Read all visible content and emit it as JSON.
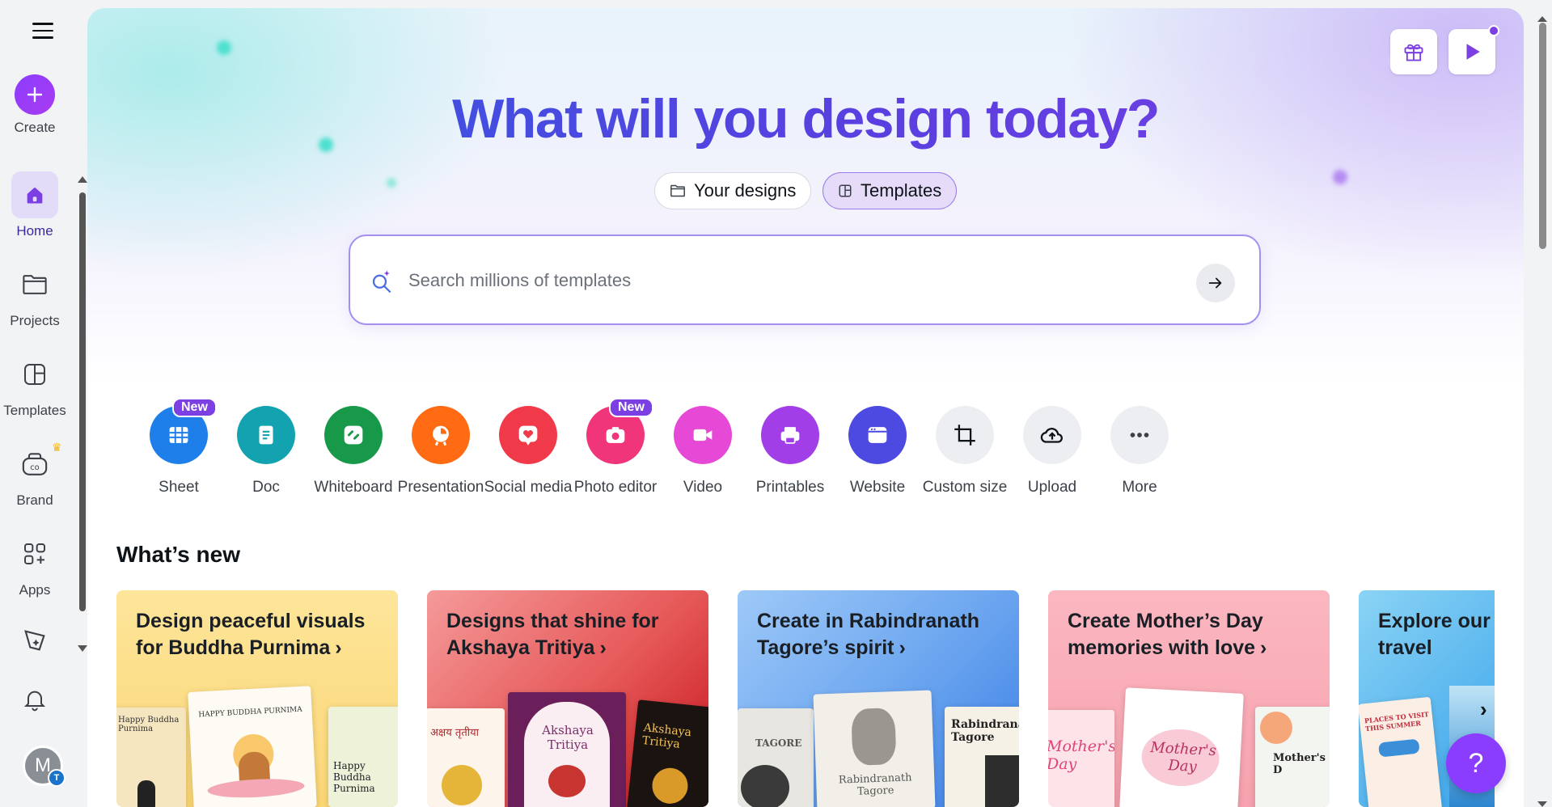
{
  "rail": {
    "create_label": "Create",
    "items": [
      {
        "label": "Home"
      },
      {
        "label": "Projects"
      },
      {
        "label": "Templates"
      },
      {
        "label": "Brand"
      },
      {
        "label": "Apps"
      }
    ],
    "avatar_initial": "M",
    "team_initial": "T"
  },
  "hero": {
    "title": "What will you design today?",
    "tabs": [
      {
        "label": "Your designs",
        "active": false
      },
      {
        "label": "Templates",
        "active": true
      }
    ]
  },
  "search": {
    "placeholder": "Search millions of templates"
  },
  "shortcuts": [
    {
      "label": "Sheet",
      "color": "#1f7fea",
      "badge": "New",
      "icon": "sheet-icon"
    },
    {
      "label": "Doc",
      "color": "#13a3b0",
      "badge": "",
      "icon": "doc-icon"
    },
    {
      "label": "Whiteboard",
      "color": "#18994a",
      "badge": "",
      "icon": "whiteboard-icon"
    },
    {
      "label": "Presentation",
      "color": "#ff6a13",
      "badge": "",
      "icon": "presentation-icon"
    },
    {
      "label": "Social media",
      "color": "#f03a4a",
      "badge": "",
      "icon": "heart-icon"
    },
    {
      "label": "Photo editor",
      "color": "#f0357a",
      "badge": "New",
      "icon": "camera-icon"
    },
    {
      "label": "Video",
      "color": "#e649d6",
      "badge": "",
      "icon": "video-icon"
    },
    {
      "label": "Printables",
      "color": "#a23ee8",
      "badge": "",
      "icon": "printer-icon"
    },
    {
      "label": "Website",
      "color": "#4c4ae0",
      "badge": "",
      "icon": "website-icon"
    },
    {
      "label": "Custom size",
      "color": "#eceef1",
      "badge": "",
      "icon": "crop-icon"
    },
    {
      "label": "Upload",
      "color": "#eceef1",
      "badge": "",
      "icon": "cloud-upload-icon"
    },
    {
      "label": "More",
      "color": "#eceef1",
      "badge": "",
      "icon": "more-icon"
    }
  ],
  "whats_new": {
    "title": "What’s new",
    "cards": [
      {
        "title": "Design peaceful visuals for Buddha Purnima",
        "bg": "#fde08a",
        "thumbs": [
          "Happy Buddha Purnima",
          "HAPPY BUDDHA PURNIMA",
          "Happy Buddha Purnima"
        ]
      },
      {
        "title": "Designs that shine for Akshaya Tritiya",
        "bg": "#e34a4a",
        "thumbs": [
          "अक्षय तृतीया",
          "Akshaya Tritiya",
          "Akshaya Tritiya"
        ]
      },
      {
        "title": "Create in Rabindranath Tagore’s spirit",
        "bg": "#6fa8f0",
        "thumbs": [
          "TAGORE",
          "Rabindranath Tagore",
          "Rabindranath Tagore"
        ]
      },
      {
        "title": "Create Mother’s Day memories with love",
        "bg": "#f9a8b4",
        "thumbs": [
          "Mother's Day",
          "Mother's Day",
          "Mother's D"
        ]
      },
      {
        "title": "Explore our summer travel",
        "bg": "#5fb8f0",
        "thumbs": [
          "PLACES TO VISIT THIS SUMMER"
        ]
      }
    ]
  },
  "help_label": "?"
}
